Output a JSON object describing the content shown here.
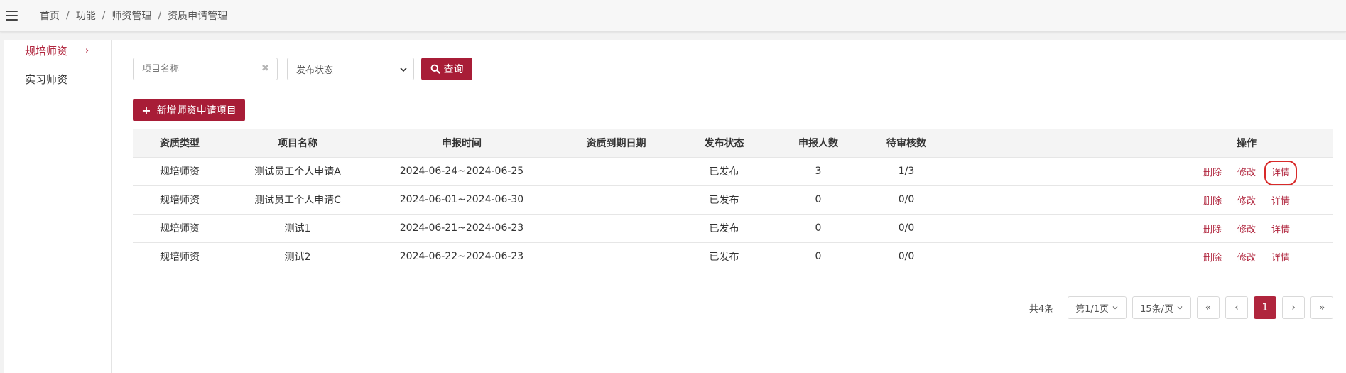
{
  "breadcrumb": [
    "首页",
    "功能",
    "师资管理",
    "资质申请管理"
  ],
  "breadcrumb_sep": "/",
  "sidebar": {
    "items": [
      {
        "label": "规培师资",
        "active": true,
        "chevron": "›"
      },
      {
        "label": "实习师资",
        "active": false
      }
    ]
  },
  "search": {
    "name_placeholder": "项目名称",
    "name_value": "",
    "clear_glyph": "✖",
    "status_selected": "发布状态",
    "query_label": "查询"
  },
  "add_button_label": "新增师资申请项目",
  "table": {
    "columns": [
      "资质类型",
      "项目名称",
      "申报时间",
      "资质到期日期",
      "发布状态",
      "申报人数",
      "待审核数",
      "操作"
    ],
    "rows": [
      [
        "规培师资",
        "测试员工个人申请A",
        "2024-06-24~2024-06-25",
        "",
        "已发布",
        "3",
        "1/3"
      ],
      [
        "规培师资",
        "测试员工个人申请C",
        "2024-06-01~2024-06-30",
        "",
        "已发布",
        "0",
        "0/0"
      ],
      [
        "规培师资",
        "测试1",
        "2024-06-21~2024-06-23",
        "",
        "已发布",
        "0",
        "0/0"
      ],
      [
        "规培师资",
        "测试2",
        "2024-06-22~2024-06-23",
        "",
        "已发布",
        "0",
        "0/0"
      ]
    ],
    "actions": [
      "删除",
      "修改",
      "详情"
    ]
  },
  "pagination": {
    "total": "共4条",
    "page_select": "第1/1页",
    "size_select": "15条/页",
    "first": "«",
    "prev": "‹",
    "current": "1",
    "next": "›",
    "last": "»"
  },
  "colors": {
    "accent": "#a81d37",
    "link": "#b0253d",
    "highlight_box": "#d82a2a"
  }
}
